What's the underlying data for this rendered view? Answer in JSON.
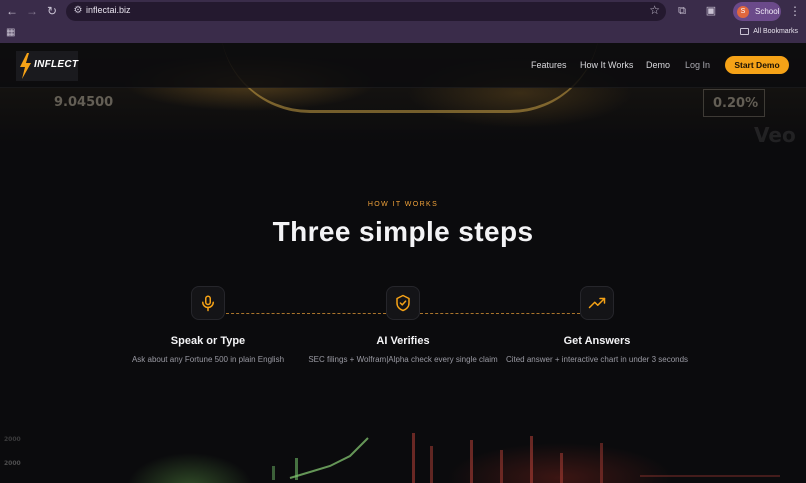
{
  "browser": {
    "url": "inflectai.biz",
    "profile_name": "School",
    "profile_initial": "S",
    "bookmarks_label": "All Bookmarks"
  },
  "site": {
    "logo_text": "INFLECT",
    "nav": [
      {
        "label": "Features"
      },
      {
        "label": "How It Works"
      },
      {
        "label": "Demo"
      },
      {
        "label": "Log In"
      }
    ],
    "cta_label": "Start Demo",
    "hero_numbers": [
      "9.04500",
      "0.20%",
      "Veo"
    ],
    "eyebrow": "HOW IT WORKS",
    "title": "Three simple steps",
    "steps": [
      {
        "icon": "microphone-icon",
        "title": "Speak or Type",
        "desc": "Ask about any Fortune 500 in plain English"
      },
      {
        "icon": "shield-check-icon",
        "title": "AI Verifies",
        "desc": "SEC filings + Wolfram|Alpha check every single claim"
      },
      {
        "icon": "trending-up-icon",
        "title": "Get Answers",
        "desc": "Cited answer + interactive chart in under 3 seconds"
      }
    ],
    "bottom_numbers": [
      "2000",
      "2000"
    ],
    "accent_color": "#f5a217"
  }
}
